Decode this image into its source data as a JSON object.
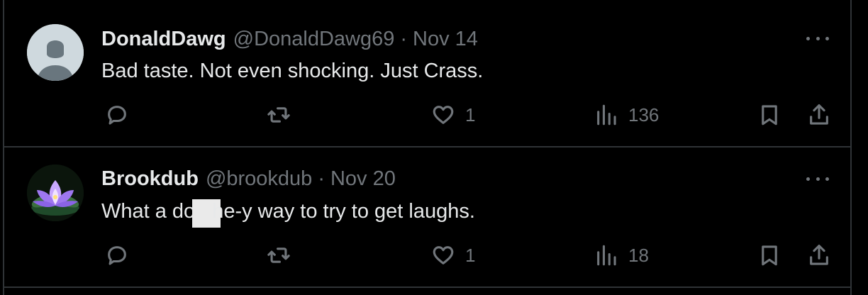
{
  "tweets": [
    {
      "display_name": "DonaldDawg",
      "handle": "@DonaldDawg69",
      "separator": "·",
      "date": "Nov 14",
      "text": "Bad taste. Not even shocking. Just Crass.",
      "text_before_redaction": "Bad taste. Not even shocking. Just Crass.",
      "text_after_redaction": "",
      "redacted": false,
      "avatar": "default-person-avatar",
      "likes": "1",
      "views": "136"
    },
    {
      "display_name": "Brookdub",
      "handle": "@brookdub",
      "separator": "·",
      "date": "Nov 20",
      "text_before_redaction": "What a do",
      "text_after_redaction": "he-y way to try to get laughs.",
      "redacted": true,
      "avatar": "lotus-flower-avatar",
      "likes": "1",
      "views": "18"
    }
  ],
  "icons": {
    "reply": "reply-icon",
    "retweet": "retweet-icon",
    "like": "heart-icon",
    "views": "views-chart-icon",
    "bookmark": "bookmark-icon",
    "share": "share-icon",
    "more": "more-dots-icon"
  },
  "colors": {
    "background": "#000000",
    "primary_text": "#e7e9ea",
    "secondary_text": "#71767b",
    "border": "#2f3336"
  }
}
